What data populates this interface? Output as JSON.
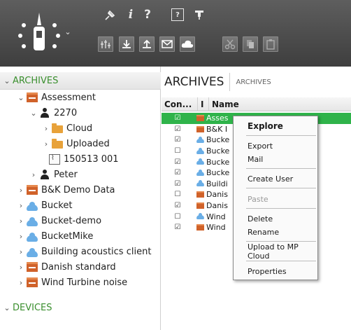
{
  "toolbar": {
    "icons_row1": [
      "pin-icon",
      "info-icon",
      "help-icon",
      "window-help-icon",
      "pin-window-icon"
    ],
    "icons_row2": [
      "scale-icon",
      "download-icon",
      "upload-icon",
      "mail-icon",
      "cloud-icon",
      "cut-icon",
      "copy-icon",
      "paste-icon"
    ]
  },
  "left": {
    "archives_label": "ARCHIVES",
    "devices_label": "DEVICES",
    "tree": [
      {
        "label": "Assessment",
        "icon": "archive",
        "chev": "v"
      },
      {
        "label": "2270",
        "icon": "person",
        "chev": "v"
      },
      {
        "label": "Cloud",
        "icon": "folder",
        "chev": ">"
      },
      {
        "label": "Uploaded",
        "icon": "folder",
        "chev": ">"
      },
      {
        "label": "150513 001",
        "icon": "graph",
        "chev": ""
      },
      {
        "label": "Peter",
        "icon": "person",
        "chev": ">"
      },
      {
        "label": "B&K Demo Data",
        "icon": "archive",
        "chev": ">"
      },
      {
        "label": "Bucket",
        "icon": "cloud",
        "chev": ">"
      },
      {
        "label": "Bucket-demo",
        "icon": "cloud",
        "chev": ">"
      },
      {
        "label": "BucketMike",
        "icon": "cloud",
        "chev": ">"
      },
      {
        "label": "Building acoustics client",
        "icon": "cloud",
        "chev": ">"
      },
      {
        "label": "Danish standard",
        "icon": "archive",
        "chev": ">"
      },
      {
        "label": "Wind Turbine noise",
        "icon": "archive",
        "chev": ">"
      }
    ]
  },
  "right": {
    "title": "ARCHIVES",
    "subtab": "ARCHIVES",
    "columns": [
      "Con...",
      "I",
      "Name"
    ],
    "rows": [
      {
        "checked": true,
        "icon": "archive",
        "name": "Asses"
      },
      {
        "checked": true,
        "icon": "archive",
        "name": "B&K I"
      },
      {
        "checked": true,
        "icon": "cloud",
        "name": "Bucke"
      },
      {
        "checked": false,
        "icon": "cloud",
        "name": "Bucke"
      },
      {
        "checked": true,
        "icon": "cloud",
        "name": "Bucke"
      },
      {
        "checked": true,
        "icon": "cloud",
        "name": "Bucke"
      },
      {
        "checked": true,
        "icon": "cloud",
        "name": "Buildi"
      },
      {
        "checked": false,
        "icon": "archive",
        "name": "Danis"
      },
      {
        "checked": true,
        "icon": "archive",
        "name": "Danis"
      },
      {
        "checked": false,
        "icon": "cloud",
        "name": "Wind"
      },
      {
        "checked": true,
        "icon": "archive",
        "name": "Wind"
      }
    ]
  },
  "context_menu": {
    "items": [
      "Explore",
      "Export",
      "Mail",
      "Create User",
      "Paste",
      "Delete",
      "Rename",
      "Upload to MP Cloud",
      "Properties"
    ]
  },
  "colors": {
    "accent_green": "#2fb34a",
    "section_green": "#3a8f2e",
    "archive_orange": "#d0622a",
    "cloud_blue": "#6aaee6"
  }
}
